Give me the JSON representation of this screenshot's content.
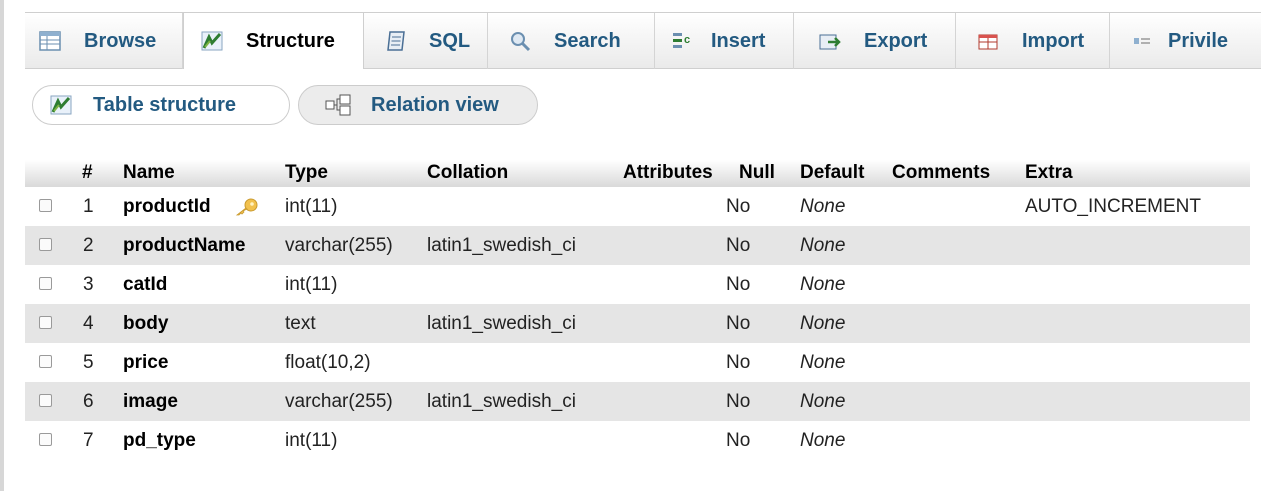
{
  "tabs": [
    {
      "label": "Browse",
      "icon": "browse-icon"
    },
    {
      "label": "Structure",
      "icon": "structure-icon",
      "active": true
    },
    {
      "label": "SQL",
      "icon": "sql-icon"
    },
    {
      "label": "Search",
      "icon": "search-icon"
    },
    {
      "label": "Insert",
      "icon": "insert-icon"
    },
    {
      "label": "Export",
      "icon": "export-icon"
    },
    {
      "label": "Import",
      "icon": "import-icon"
    },
    {
      "label": "Privile",
      "icon": "privileges-icon"
    }
  ],
  "subtabs": [
    {
      "label": "Table structure",
      "icon": "structure-icon",
      "active": true
    },
    {
      "label": "Relation view",
      "icon": "relation-icon"
    }
  ],
  "table": {
    "headers": {
      "num": "#",
      "name": "Name",
      "type": "Type",
      "collation": "Collation",
      "attributes": "Attributes",
      "null": "Null",
      "default": "Default",
      "comments": "Comments",
      "extra": "Extra"
    },
    "rows": [
      {
        "num": "1",
        "name": "productId",
        "type": "int(11)",
        "collation": "",
        "null": "No",
        "default": "None",
        "extra": "AUTO_INCREMENT",
        "primary_key": true
      },
      {
        "num": "2",
        "name": "productName",
        "type": "varchar(255)",
        "collation": "latin1_swedish_ci",
        "null": "No",
        "default": "None",
        "extra": ""
      },
      {
        "num": "3",
        "name": "catId",
        "type": "int(11)",
        "collation": "",
        "null": "No",
        "default": "None",
        "extra": ""
      },
      {
        "num": "4",
        "name": "body",
        "type": "text",
        "collation": "latin1_swedish_ci",
        "null": "No",
        "default": "None",
        "extra": ""
      },
      {
        "num": "5",
        "name": "price",
        "type": "float(10,2)",
        "collation": "",
        "null": "No",
        "default": "None",
        "extra": ""
      },
      {
        "num": "6",
        "name": "image",
        "type": "varchar(255)",
        "collation": "latin1_swedish_ci",
        "null": "No",
        "default": "None",
        "extra": ""
      },
      {
        "num": "7",
        "name": "pd_type",
        "type": "int(11)",
        "collation": "",
        "null": "No",
        "default": "None",
        "extra": ""
      }
    ]
  },
  "colors": {
    "link": "#235a81",
    "row_alt": "#e5e5e5",
    "key_icon": "#f2c14e"
  }
}
